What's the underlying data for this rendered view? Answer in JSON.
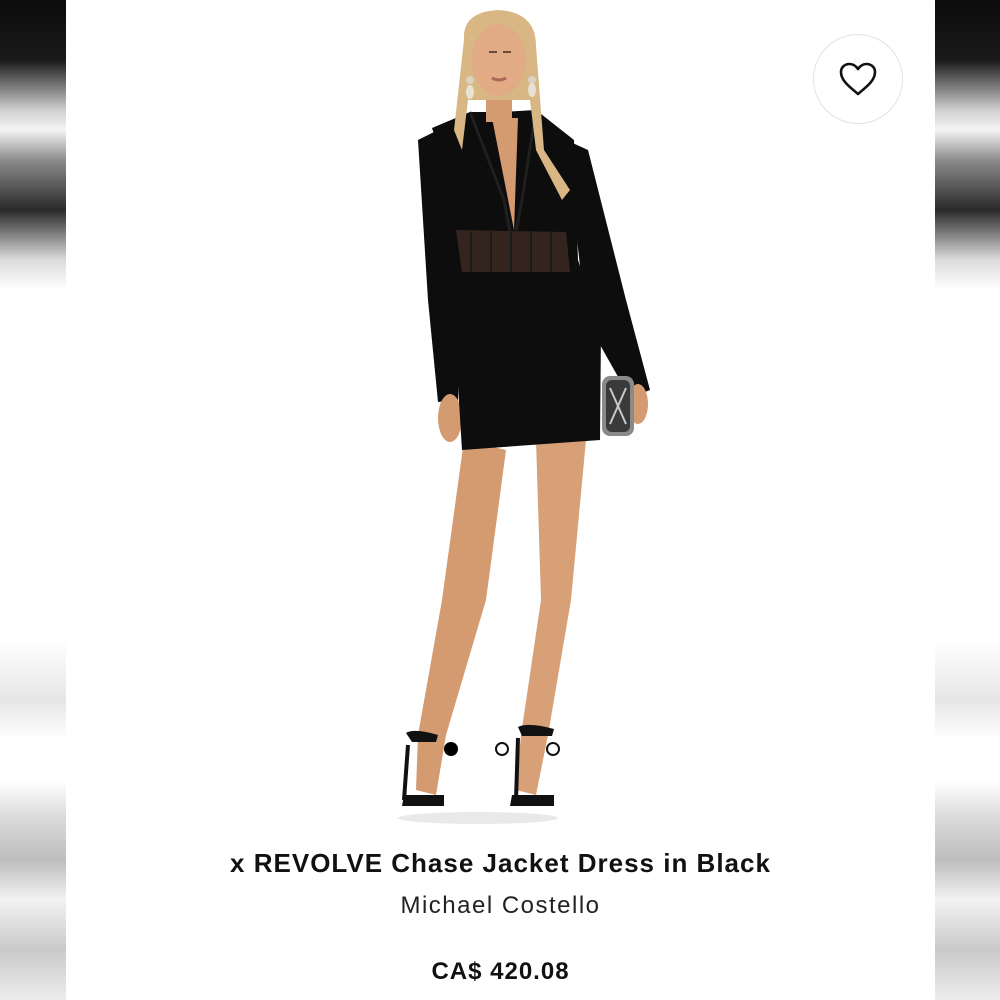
{
  "product": {
    "title": "x REVOLVE Chase Jacket Dress in Black",
    "brand": "Michael Costello",
    "price": "CA$ 420.08"
  },
  "gallery": {
    "image_count": 4,
    "active_index": 0
  },
  "icons": {
    "favorite": "heart-outline-icon"
  },
  "colors": {
    "text": "#111111",
    "dress": "#0d0d0d",
    "skin": "#d9a27a",
    "hair": "#d8b784"
  }
}
